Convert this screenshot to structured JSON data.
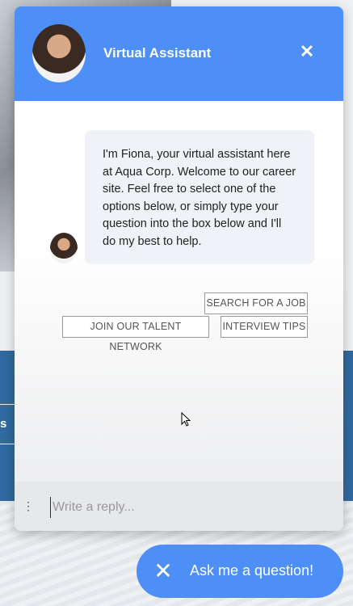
{
  "background": {
    "tab_text": "s"
  },
  "header": {
    "title": "Virtual Assistant",
    "close_glyph": "✕"
  },
  "message": {
    "text": "I'm Fiona, your virtual assistant here at Aqua Corp. Welcome to our career site. Feel free to select one of the options below, or simply type your question into the box below and I'll do my best to help."
  },
  "options": [
    "SEARCH FOR A JOB",
    "JOIN OUR TALENT NETWORK",
    "INTERVIEW TIPS"
  ],
  "input": {
    "placeholder": "Write a reply...",
    "menu_glyph": "⋮"
  },
  "launcher": {
    "label": "Ask me a question!",
    "icon_glyph": "✕"
  },
  "colors": {
    "accent": "#4d8ff6",
    "band": "#2f6aa1"
  },
  "icons": [
    "close-icon",
    "avatar",
    "cursor-icon",
    "menu-dots-icon",
    "launcher-close-icon"
  ]
}
